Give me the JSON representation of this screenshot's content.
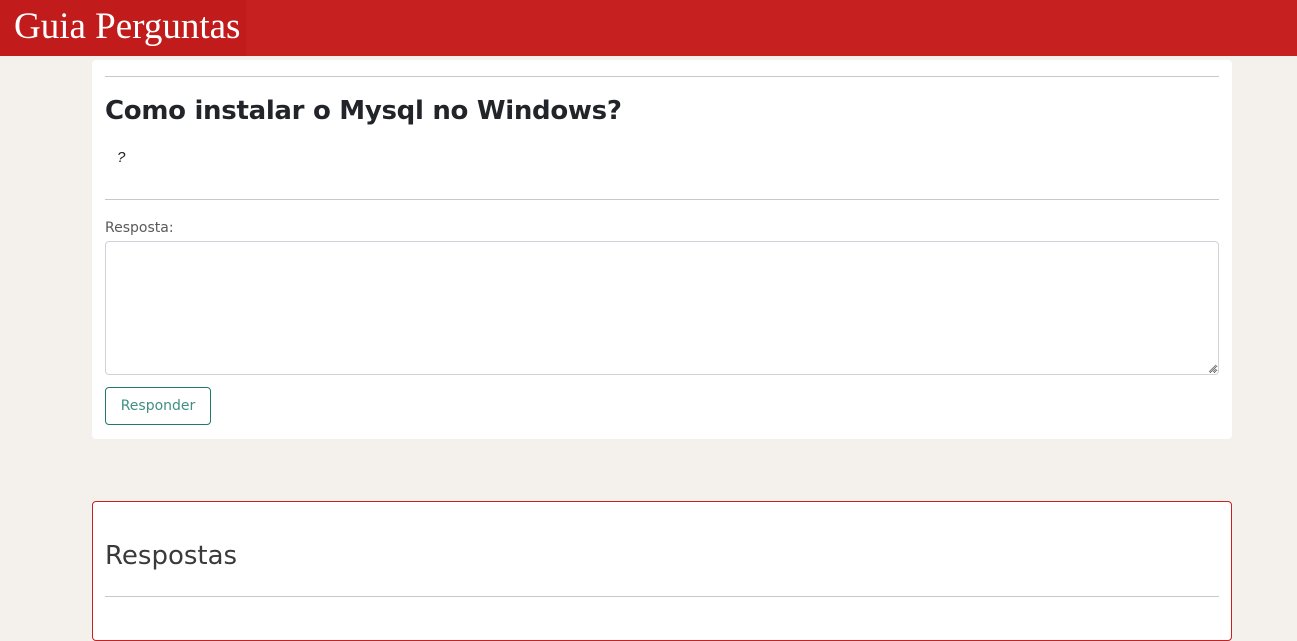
{
  "header": {
    "brand": "Guia Perguntas",
    "brand_color": "#c62020"
  },
  "question": {
    "title": "Como instalar o Mysql no Windows?",
    "description": "?"
  },
  "answer_form": {
    "label": "Resposta:",
    "textarea_value": "",
    "submit_label": "Responder",
    "button_color": "#1f7a6a"
  },
  "answers": {
    "title": "Respostas"
  },
  "colors": {
    "background": "#f4f1ec",
    "card": "#ffffff",
    "accent": "#c62020"
  }
}
